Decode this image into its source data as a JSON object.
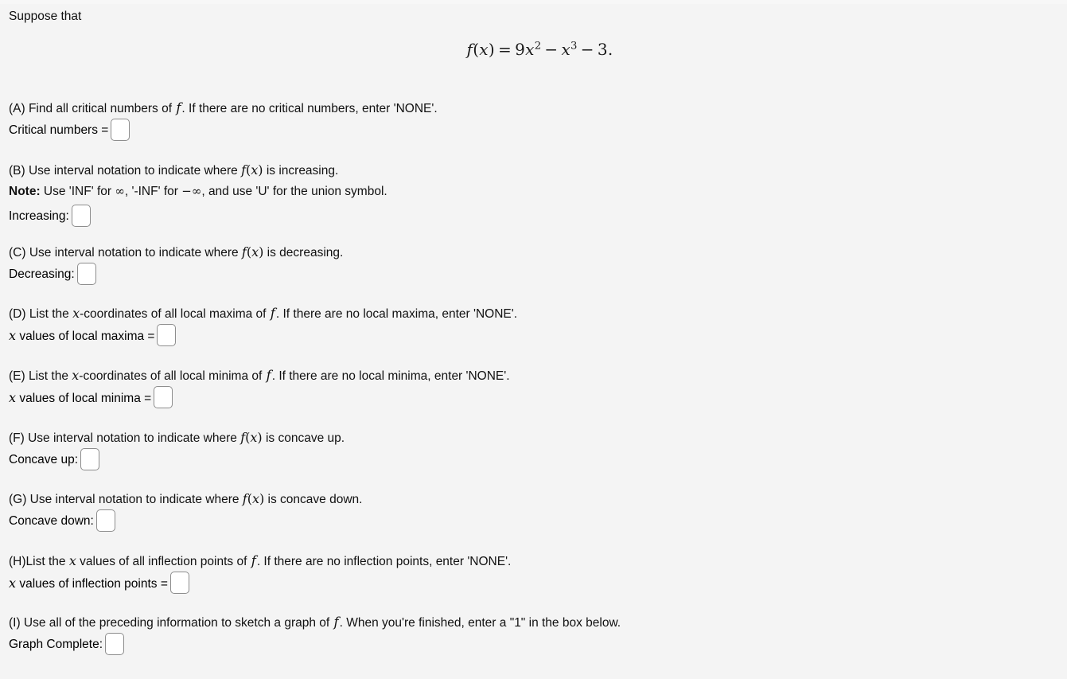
{
  "page": {
    "background_color": "#f4f4f4",
    "text_color": "#111111",
    "intro": "Suppose that"
  },
  "equation": {
    "lhs": "f(x)",
    "equals": "=",
    "term1_coeff": "9",
    "term1_var": "x",
    "term1_exp": "2",
    "op1": "−",
    "term2_var": "x",
    "term2_exp": "3",
    "op2": "−",
    "term3": "3",
    "period": ".",
    "plain": "f(x) = 9x^2 - x^3 - 3."
  },
  "parts": [
    {
      "id": "A",
      "prompt_before_f": "(A) Find all critical numbers of ",
      "f_symbol": "f",
      "prompt_after_f": ". If there are no critical numbers, enter 'NONE'.",
      "answer_label": "Critical numbers =",
      "input_value": "",
      "input_placeholder": ""
    },
    {
      "id": "B",
      "prompt_before_f": "(B) Use interval notation to indicate where ",
      "f_symbol": "f(x)",
      "prompt_after_f": " is increasing.",
      "note_label": "Note:",
      "note_part1": " Use 'INF' for ",
      "note_inf": "∞",
      "note_part2": ", '-INF' for ",
      "note_neg_inf": "−∞",
      "note_part3": ", and use 'U' for the union symbol.",
      "answer_label": "Increasing:",
      "input_value": "",
      "input_placeholder": ""
    },
    {
      "id": "C",
      "prompt_before_f": "(C) Use interval notation to indicate where ",
      "f_symbol": "f(x)",
      "prompt_after_f": " is decreasing.",
      "answer_label": "Decreasing:",
      "input_value": "",
      "input_placeholder": ""
    },
    {
      "id": "D",
      "prompt_part1": "(D) List the ",
      "prompt_x": "x",
      "prompt_part2": "-coordinates of all local maxima of ",
      "f_symbol": "f",
      "prompt_after_f": ". If there are no local maxima, enter 'NONE'.",
      "answer_label_x": "x",
      "answer_label_rest": " values of local maxima =",
      "input_value": "",
      "input_placeholder": ""
    },
    {
      "id": "E",
      "prompt_part1": "(E) List the ",
      "prompt_x": "x",
      "prompt_part2": "-coordinates of all local minima of ",
      "f_symbol": "f",
      "prompt_after_f": ". If there are no local minima, enter 'NONE'.",
      "answer_label_x": "x",
      "answer_label_rest": " values of local minima =",
      "input_value": "",
      "input_placeholder": ""
    },
    {
      "id": "F",
      "prompt_before_f": "(F) Use interval notation to indicate where ",
      "f_symbol": "f(x)",
      "prompt_after_f": " is concave up.",
      "answer_label": "Concave up:",
      "input_value": "",
      "input_placeholder": ""
    },
    {
      "id": "G",
      "prompt_before_f": "(G) Use interval notation to indicate where ",
      "f_symbol": "f(x)",
      "prompt_after_f": " is concave down.",
      "answer_label": "Concave down:",
      "input_value": "",
      "input_placeholder": ""
    },
    {
      "id": "H",
      "prompt_part1": "(H)List the ",
      "prompt_x": "x",
      "prompt_part2": " values of all inflection points of ",
      "f_symbol": "f",
      "prompt_after_f": ". If there are no inflection points, enter 'NONE'.",
      "answer_label_x": "x",
      "answer_label_rest": " values of inflection points =",
      "input_value": "",
      "input_placeholder": ""
    },
    {
      "id": "I",
      "prompt_before_f": "(I) Use all of the preceding information to sketch a graph of ",
      "f_symbol": "f",
      "prompt_after_f": ". When you're finished, enter a \"1\" in the box below.",
      "answer_label": "Graph Complete:",
      "input_value": "",
      "input_placeholder": ""
    }
  ]
}
